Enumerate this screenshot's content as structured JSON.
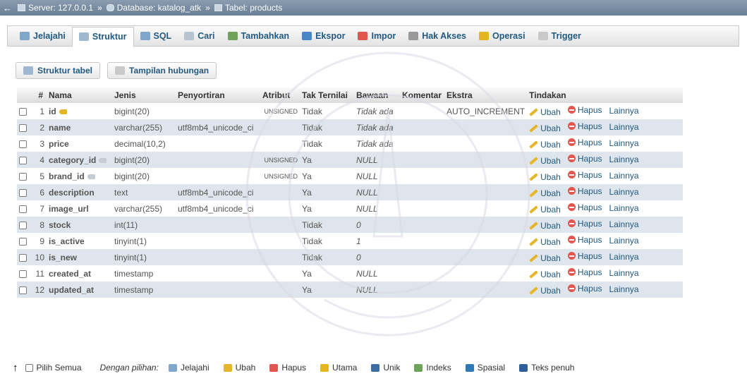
{
  "breadcrumb": {
    "server": "Server: 127.0.0.1",
    "database": "Database: katalog_atk",
    "table": "Tabel: products",
    "separator": "»"
  },
  "tabs": [
    {
      "label": "Jelajahi",
      "icon": "browse-icon",
      "active": false
    },
    {
      "label": "Struktur",
      "icon": "structure-icon",
      "active": true
    },
    {
      "label": "SQL",
      "icon": "sql-icon",
      "active": false
    },
    {
      "label": "Cari",
      "icon": "search-icon",
      "active": false
    },
    {
      "label": "Tambahkan",
      "icon": "insert-icon",
      "active": false
    },
    {
      "label": "Ekspor",
      "icon": "export-icon",
      "active": false
    },
    {
      "label": "Impor",
      "icon": "import-icon",
      "active": false
    },
    {
      "label": "Hak Akses",
      "icon": "privileges-icon",
      "active": false
    },
    {
      "label": "Operasi",
      "icon": "operations-icon",
      "active": false
    },
    {
      "label": "Trigger",
      "icon": "trigger-icon",
      "active": false
    }
  ],
  "subtabs": {
    "structure": "Struktur tabel",
    "relations": "Tampilan hubungan"
  },
  "table": {
    "headers": {
      "num": "#",
      "name": "Nama",
      "type": "Jenis",
      "collation": "Penyortiran",
      "attributes": "Atribut",
      "null": "Tak Ternilai",
      "default": "Bawaan",
      "comments": "Komentar",
      "extra": "Ekstra",
      "action": "Tindakan"
    },
    "rows": [
      {
        "num": "1",
        "name": "id",
        "key": "primary",
        "type": "bigint(20)",
        "collation": "",
        "attributes": "UNSIGNED",
        "null": "Tidak",
        "default": "Tidak ada",
        "comments": "",
        "extra": "AUTO_INCREMENT"
      },
      {
        "num": "2",
        "name": "name",
        "key": "",
        "type": "varchar(255)",
        "collation": "utf8mb4_unicode_ci",
        "attributes": "",
        "null": "Tidak",
        "default": "Tidak ada",
        "comments": "",
        "extra": ""
      },
      {
        "num": "3",
        "name": "price",
        "key": "",
        "type": "decimal(10,2)",
        "collation": "",
        "attributes": "",
        "null": "Tidak",
        "default": "Tidak ada",
        "comments": "",
        "extra": ""
      },
      {
        "num": "4",
        "name": "category_id",
        "key": "index",
        "type": "bigint(20)",
        "collation": "",
        "attributes": "UNSIGNED",
        "null": "Ya",
        "default": "NULL",
        "comments": "",
        "extra": ""
      },
      {
        "num": "5",
        "name": "brand_id",
        "key": "index",
        "type": "bigint(20)",
        "collation": "",
        "attributes": "UNSIGNED",
        "null": "Ya",
        "default": "NULL",
        "comments": "",
        "extra": ""
      },
      {
        "num": "6",
        "name": "description",
        "key": "",
        "type": "text",
        "collation": "utf8mb4_unicode_ci",
        "attributes": "",
        "null": "Ya",
        "default": "NULL",
        "comments": "",
        "extra": ""
      },
      {
        "num": "7",
        "name": "image_url",
        "key": "",
        "type": "varchar(255)",
        "collation": "utf8mb4_unicode_ci",
        "attributes": "",
        "null": "Ya",
        "default": "NULL",
        "comments": "",
        "extra": ""
      },
      {
        "num": "8",
        "name": "stock",
        "key": "",
        "type": "int(11)",
        "collation": "",
        "attributes": "",
        "null": "Tidak",
        "default": "0",
        "comments": "",
        "extra": ""
      },
      {
        "num": "9",
        "name": "is_active",
        "key": "",
        "type": "tinyint(1)",
        "collation": "",
        "attributes": "",
        "null": "Tidak",
        "default": "1",
        "comments": "",
        "extra": ""
      },
      {
        "num": "10",
        "name": "is_new",
        "key": "",
        "type": "tinyint(1)",
        "collation": "",
        "attributes": "",
        "null": "Tidak",
        "default": "0",
        "comments": "",
        "extra": ""
      },
      {
        "num": "11",
        "name": "created_at",
        "key": "",
        "type": "timestamp",
        "collation": "",
        "attributes": "",
        "null": "Ya",
        "default": "NULL",
        "comments": "",
        "extra": ""
      },
      {
        "num": "12",
        "name": "updated_at",
        "key": "",
        "type": "timestamp",
        "collation": "",
        "attributes": "",
        "null": "Ya",
        "default": "NULL",
        "comments": "",
        "extra": ""
      }
    ],
    "actions": {
      "edit": "Ubah",
      "drop": "Hapus",
      "more": "Lainnya"
    }
  },
  "footer": {
    "check_all": "Pilih Semua",
    "with_selected": "Dengan pilihan:",
    "actions": [
      {
        "label": "Jelajahi",
        "icon": "browse-icon",
        "color": "#7fa7c9"
      },
      {
        "label": "Ubah",
        "icon": "pencil-icon",
        "color": "#e5b62a"
      },
      {
        "label": "Hapus",
        "icon": "delete-icon",
        "color": "#e1574f"
      },
      {
        "label": "Utama",
        "icon": "primary-key-icon",
        "color": "#e3b521"
      },
      {
        "label": "Unik",
        "icon": "unique-icon",
        "color": "#3b6ea5"
      },
      {
        "label": "Indeks",
        "icon": "index-icon",
        "color": "#6fa35b"
      },
      {
        "label": "Spasial",
        "icon": "spatial-icon",
        "color": "#2f79b7"
      },
      {
        "label": "Teks penuh",
        "icon": "fulltext-icon",
        "color": "#2f5f9a"
      }
    ]
  },
  "colors": {
    "accent": "#235a81",
    "row_alt": "#dfe5ec",
    "breadcrumb_bg": "#7a8da3"
  }
}
